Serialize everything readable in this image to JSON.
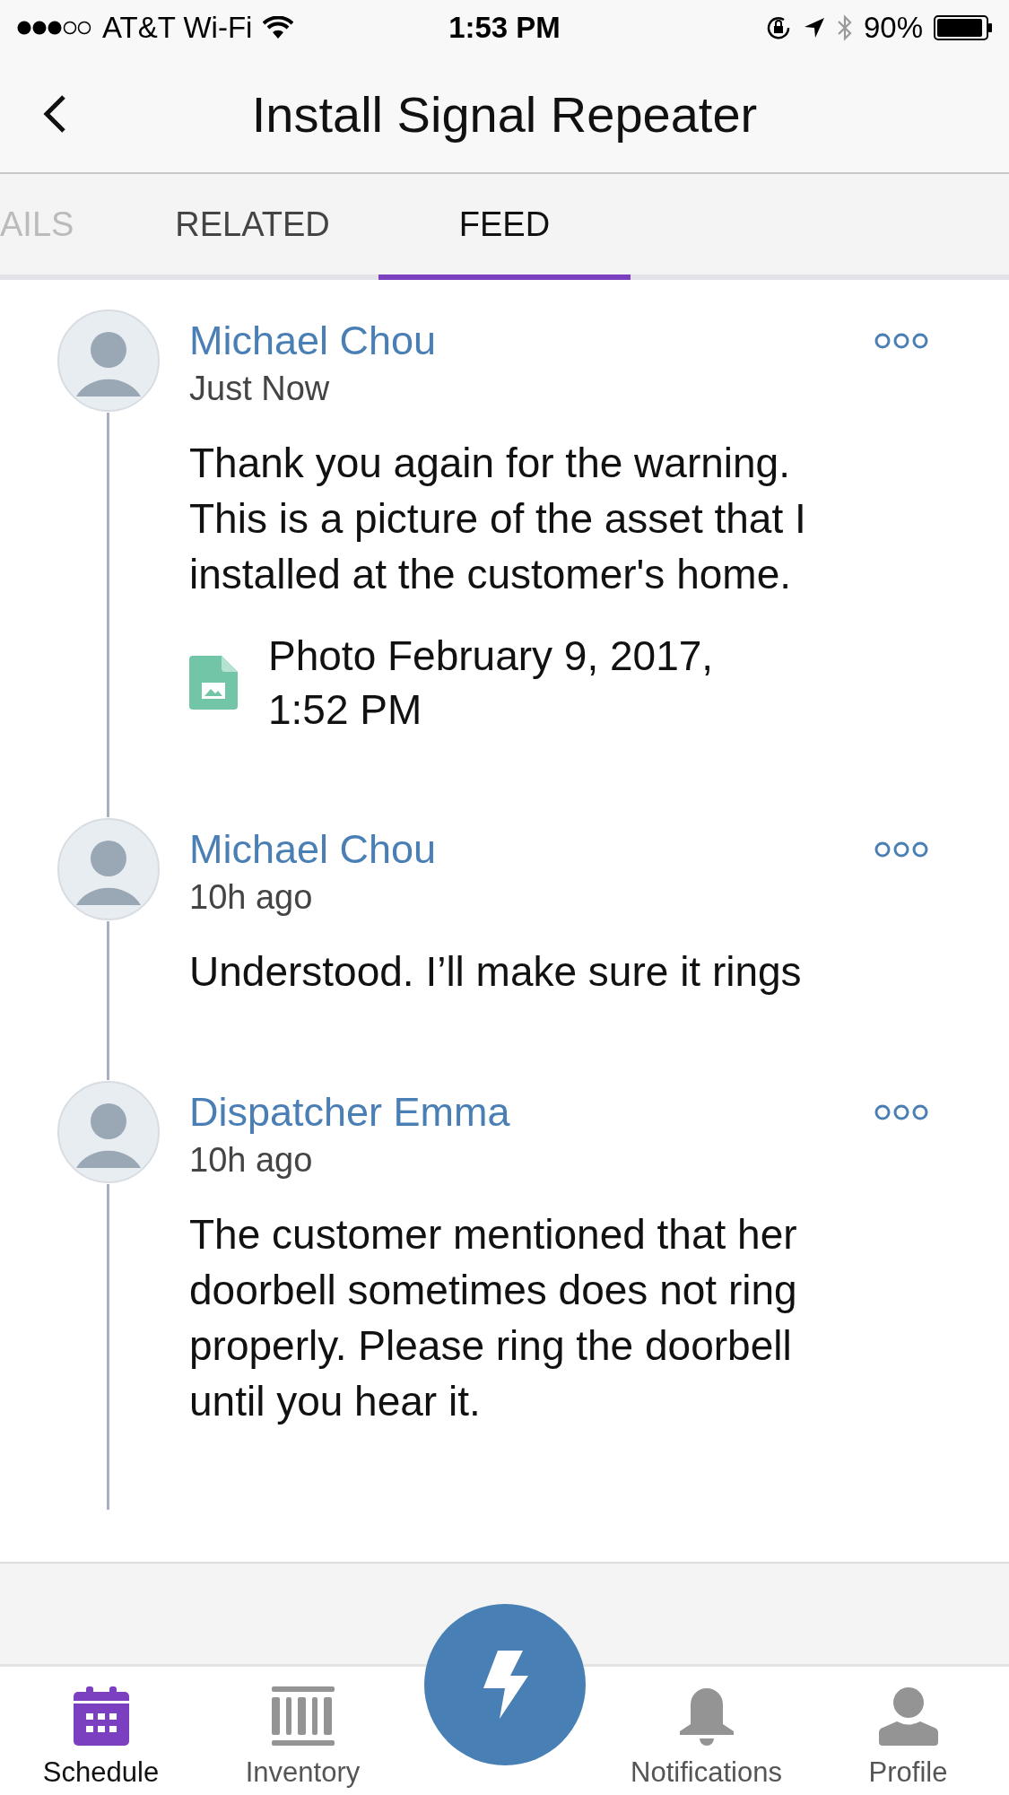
{
  "status_bar": {
    "carrier": "AT&T Wi-Fi",
    "time": "1:53 PM",
    "battery": "90%"
  },
  "header": {
    "title": "Install Signal Repeater"
  },
  "tabs": [
    {
      "label": "AILS",
      "selected": false
    },
    {
      "label": "RELATED",
      "selected": false
    },
    {
      "label": "FEED",
      "selected": true
    }
  ],
  "feed": [
    {
      "author": "Michael Chou",
      "time": "Just Now",
      "body": "Thank you again for the warning. This is a picture of the asset that I installed at the customer's home.",
      "attachment": "Photo February 9, 2017, 1:52 PM"
    },
    {
      "author": "Michael Chou",
      "time": "10h ago",
      "body": "Understood. I’ll make sure it rings"
    },
    {
      "author": "Dispatcher Emma",
      "time": "10h ago",
      "body": "The customer mentioned that her doorbell sometimes does not ring properly. Please ring the doorbell until you hear it."
    }
  ],
  "tab_bar": [
    {
      "label": "Schedule",
      "kind": "calendar",
      "selected": true
    },
    {
      "label": "Inventory",
      "kind": "barcode",
      "selected": false
    },
    {
      "label": "Notifications",
      "kind": "bell",
      "selected": false
    },
    {
      "label": "Profile",
      "kind": "person",
      "selected": false
    }
  ]
}
